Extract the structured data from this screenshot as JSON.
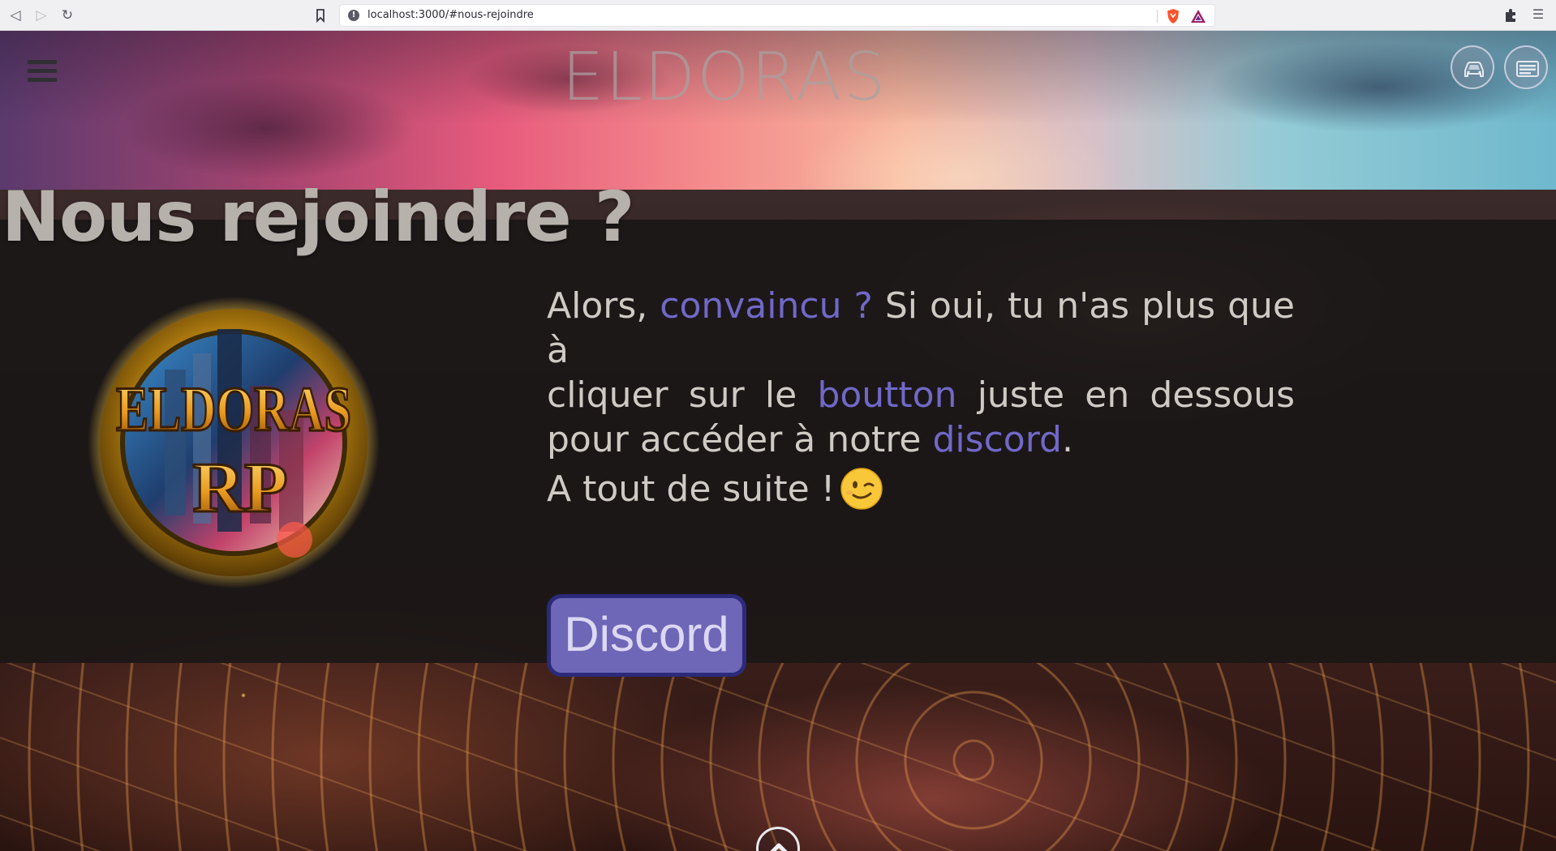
{
  "browser": {
    "url": "localhost:3000/#nous-rejoindre"
  },
  "header": {
    "brand": "ELDORAS"
  },
  "section": {
    "title": "Nous rejoindre ?",
    "intro": {
      "line1_a": "Alors, ",
      "line1_hl": "convaincu ?",
      "line1_b": " Si oui, tu n'as plus que à",
      "line2_a": "cliquer sur le ",
      "line2_hl": "boutton",
      "line2_b": " juste en dessous",
      "line3_a": "pour accéder à notre ",
      "line3_hl": "discord",
      "line3_b": "."
    },
    "outro": "A tout de suite !",
    "discord_button": "Discord"
  },
  "logo": {
    "line1": "ELDORAS",
    "line2": "RP"
  },
  "colors": {
    "highlight": "#7168c8",
    "button_bg": "#6e67b8",
    "button_border": "#2c2a7a",
    "panel": "#181616"
  },
  "icons": {
    "menu": "hamburger-icon",
    "car": "car-icon",
    "card": "id-card-icon",
    "scroll_top": "chevron-up-icon",
    "emoji": "winking-face"
  }
}
